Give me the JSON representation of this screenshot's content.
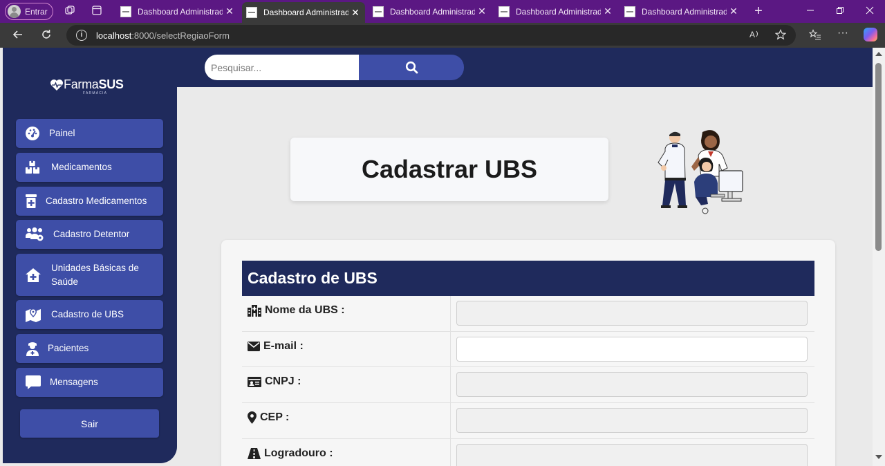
{
  "browser": {
    "profile_label": "Entrar",
    "tabs": [
      {
        "title": "Dashboard Administrado",
        "active": false
      },
      {
        "title": "Dashboard Administrado",
        "active": true
      },
      {
        "title": "Dashboard Administrado",
        "active": false
      },
      {
        "title": "Dashboard Administrado",
        "active": false
      },
      {
        "title": "Dashboard Administrado",
        "active": false
      }
    ],
    "url_host": "localhost",
    "url_path": ":8000/selectRegiaoForm"
  },
  "logo": {
    "word_light": "Farma",
    "word_bold": "SUS",
    "tagline": "FARMÁCIA"
  },
  "sidebar": {
    "items": [
      {
        "label": "Painel",
        "icon": "gauge-icon"
      },
      {
        "label": "Medicamentos",
        "icon": "boxes-icon"
      },
      {
        "label": "Cadastro Medicamentos",
        "icon": "prescription-bottle-icon"
      },
      {
        "label": "Cadastro Detentor",
        "icon": "users-gear-icon"
      },
      {
        "label": "Unidades Básicas de Saúde",
        "icon": "house-medical-icon"
      },
      {
        "label": "Cadastro de UBS",
        "icon": "map-location-icon"
      },
      {
        "label": "Pacientes",
        "icon": "user-doctor-icon"
      },
      {
        "label": "Mensagens",
        "icon": "message-icon"
      }
    ],
    "logout_label": "Sair"
  },
  "search": {
    "placeholder": "Pesquisar..."
  },
  "page": {
    "title": "Cadastrar UBS"
  },
  "form": {
    "heading": "Cadastro de UBS",
    "fields": [
      {
        "label": "Nome da UBS :",
        "icon": "hospital-icon",
        "value": ""
      },
      {
        "label": "E-mail :",
        "icon": "envelope-icon",
        "value": ""
      },
      {
        "label": "CNPJ :",
        "icon": "id-card-icon",
        "value": ""
      },
      {
        "label": "CEP :",
        "icon": "location-pin-icon",
        "value": ""
      },
      {
        "label": "Logradouro :",
        "icon": "road-icon",
        "value": ""
      }
    ]
  }
}
